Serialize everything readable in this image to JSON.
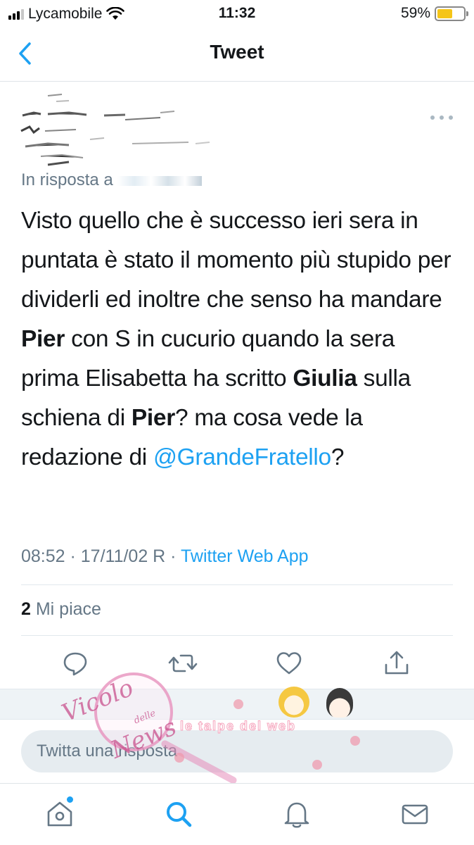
{
  "status_bar": {
    "carrier": "Lycamobile",
    "time": "11:32",
    "battery_percent": "59%",
    "battery_level": 0.59,
    "battery_color": "#f5c518"
  },
  "nav": {
    "title": "Tweet",
    "back_icon": "chevron-left-icon"
  },
  "tweet": {
    "reply_prefix": "In risposta a",
    "text": {
      "part1": "Visto quello che è successo ieri sera in puntata è stato il momento più stupido per dividerli ed inoltre che senso ha mandare ",
      "bold1": "Pier",
      "part2": " con S in cucurio quando la sera prima Elisabetta ha scritto ",
      "bold2": "Giulia",
      "part3": " sulla schiena di ",
      "bold3": "Pier",
      "part4": "? ma cosa vede la redazione di ",
      "mention": "@GrandeFratello",
      "part5": "?"
    },
    "timestamp": "08:52 · 17/11/02 R · ",
    "source": "Twitter Web App",
    "likes_count": "2",
    "likes_label": " Mi piace"
  },
  "actions": [
    "reply-icon",
    "retweet-icon",
    "like-icon",
    "share-icon"
  ],
  "watermark": {
    "script_1": "Vicolo",
    "script_2": "delle",
    "script_3": "News",
    "brand": "le talpe del web"
  },
  "reply_box": {
    "placeholder": "Twitta una risposta"
  },
  "tab_bar": [
    "home-icon",
    "search-icon",
    "notifications-icon",
    "messages-icon"
  ],
  "colors": {
    "accent": "#1da1f2",
    "secondary_text": "#657786",
    "primary_text": "#14171a"
  }
}
